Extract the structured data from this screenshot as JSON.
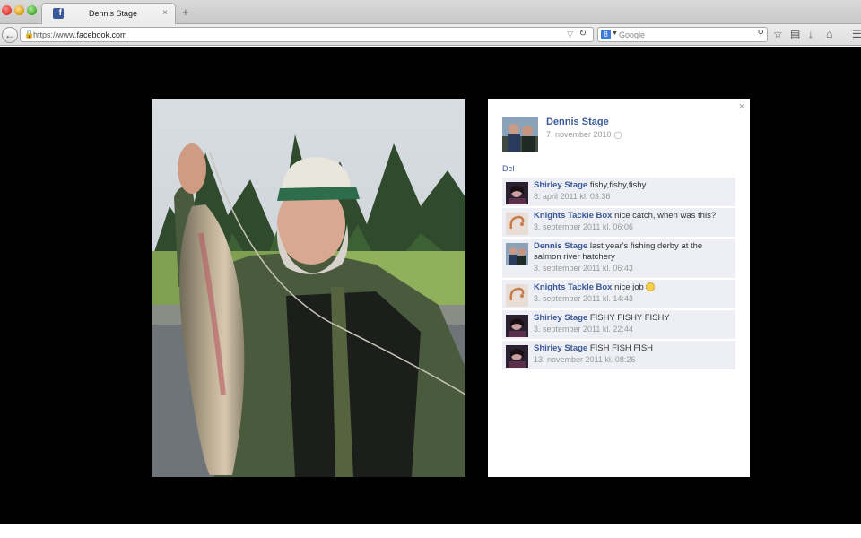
{
  "browser": {
    "tab_title": "Dennis  Stage",
    "tab_close": "×",
    "new_tab": "+",
    "url_prefix": "https://www.",
    "url_domain": "facebook.com",
    "search_placeholder": "Google"
  },
  "post": {
    "owner_name": "Dennis Stage",
    "date": "7. november 2010",
    "share_label": "Del",
    "close_label": "×"
  },
  "comments": [
    {
      "name": "Shirley Stage",
      "text": "fishy,fishy,fishy",
      "date": "8. april 2011 kl. 03:36"
    },
    {
      "name": "Knights Tackle Box",
      "text": "nice catch, when was this?",
      "date": "3. september 2011 kl. 06:06"
    },
    {
      "name": "Dennis Stage",
      "text": "last year's fishing derby at the salmon river hatchery",
      "date": "3. september 2011 kl. 06:43"
    },
    {
      "name": "Knights Tackle Box",
      "text": "nice job",
      "date": "3. september 2011 kl. 14:43"
    },
    {
      "name": "Shirley Stage",
      "text": "FISHY FISHY FISHY",
      "date": "3. september 2011 kl. 22:44"
    },
    {
      "name": "Shirley Stage",
      "text": "FISH FISH FISH",
      "date": "13. november 2011 kl. 08:26"
    }
  ],
  "colors": {
    "facebook_blue": "#3b5998",
    "comment_bg": "#edeff4",
    "meta_gray": "#999999"
  },
  "icons": [
    "facebook-favicon",
    "back-arrow-icon",
    "lock-icon",
    "reload-icon",
    "google-icon",
    "search-icon",
    "star-icon",
    "clipboard-icon",
    "download-icon",
    "home-icon",
    "menu-icon",
    "globe-icon",
    "close-icon",
    "smiley-emoticon-icon"
  ]
}
